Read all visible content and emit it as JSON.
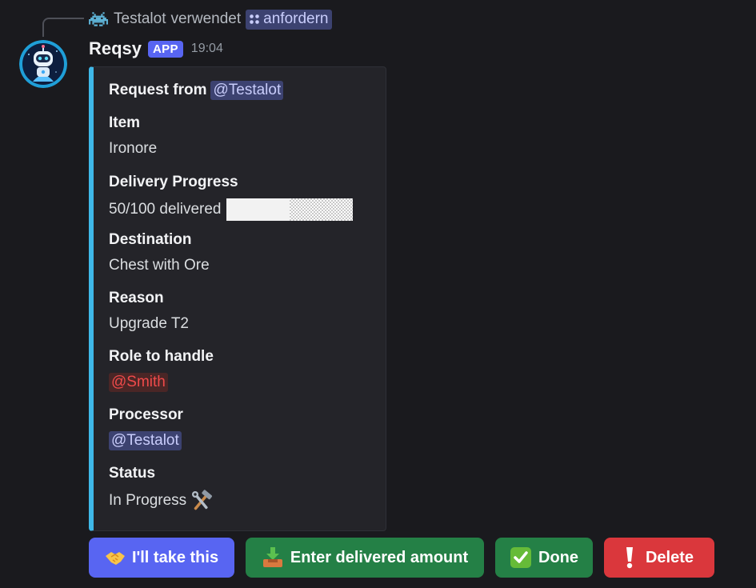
{
  "reply": {
    "user": "Testalot",
    "action": "verwendet",
    "command": "anfordern",
    "user_icon": "space-invader-icon",
    "command_icon": "app-command-icon"
  },
  "message": {
    "author": "Reqsy",
    "badge": "APP",
    "time": "19:04",
    "avatar": "robot-avatar"
  },
  "embed": {
    "accent_color": "#3fb8e8",
    "request_from_label": "Request from",
    "request_from_mention": "@Testalot",
    "item_label": "Item",
    "item_value": "Ironore",
    "progress_label": "Delivery Progress",
    "progress_value": "50/100 delivered",
    "progress_fraction": 0.5,
    "destination_label": "Destination",
    "destination_value": "Chest with Ore",
    "reason_label": "Reason",
    "reason_value": "Upgrade T2",
    "role_label": "Role to handle",
    "role_value": "@Smith",
    "processor_label": "Processor",
    "processor_value": "@Testalot",
    "status_label": "Status",
    "status_value": "In Progress",
    "status_icon": "hammer-and-wrench-icon"
  },
  "buttons": {
    "take_label": "I'll take this",
    "take_icon": "handshake-icon",
    "enter_label": "Enter delivered amount",
    "enter_icon": "inbox-tray-icon",
    "done_label": "Done",
    "done_icon": "check-mark-icon",
    "delete_label": "Delete",
    "delete_icon": "exclamation-icon"
  },
  "colors": {
    "background": "#1a1a1e",
    "primary_button": "#5865f2",
    "success_button": "#248046",
    "danger_button": "#da373c",
    "mention_bg": "#3c4270",
    "role_mention_text": "#f04a4a"
  }
}
